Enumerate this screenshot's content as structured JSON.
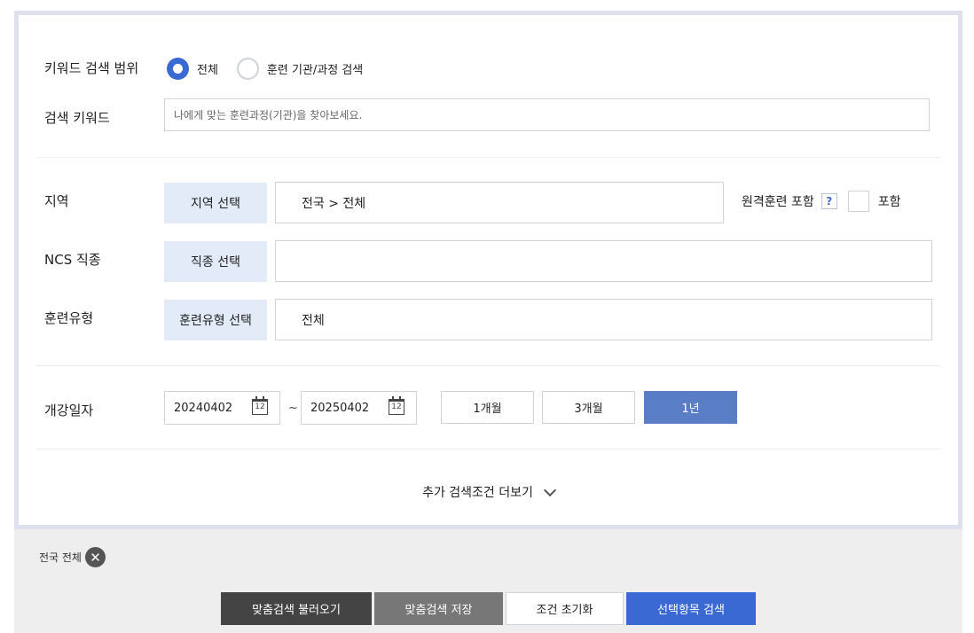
{
  "scope": {
    "label": "키워드 검색 범위",
    "options": [
      {
        "label": "전체",
        "selected": true
      },
      {
        "label": "훈련 기관/과정 검색",
        "selected": false
      }
    ]
  },
  "keyword": {
    "label": "검색 키워드",
    "value": "",
    "placeholder": "나에게 맞는 훈련과정(기관)을 찾아보세요."
  },
  "region": {
    "label": "지역",
    "button": "지역 선택",
    "value": "전국 > 전체",
    "remote_label": "원격훈련 포함",
    "remote_help": "?",
    "remote_include": "포함",
    "remote_checked": false
  },
  "ncs": {
    "label": "NCS 직종",
    "button": "직종 선택",
    "value": ""
  },
  "training_type": {
    "label": "훈련유형",
    "button": "훈련유형 선택",
    "value": "전체"
  },
  "date": {
    "label": "개강일자",
    "start": "20240402",
    "end": "20250402",
    "separator": "~",
    "calendar_glyph": "12",
    "periods": [
      {
        "label": "1개월",
        "active": false
      },
      {
        "label": "3개월",
        "active": false
      },
      {
        "label": "1년",
        "active": true
      }
    ]
  },
  "more_label": "추가 검색조건 더보기",
  "chip": {
    "label": "전국 전체",
    "close": "✕"
  },
  "actions": {
    "load": "맞춤검색 불러오기",
    "save": "맞춤검색 저장",
    "reset": "조건 초기화",
    "search": "선택항목 검색"
  },
  "colors": {
    "accent": "#3a69d4",
    "active_period": "#5a7ec6",
    "select_button_bg": "#e3ebf8",
    "panel_border": "#dde1ee",
    "footer_bg": "#eeeeee"
  }
}
